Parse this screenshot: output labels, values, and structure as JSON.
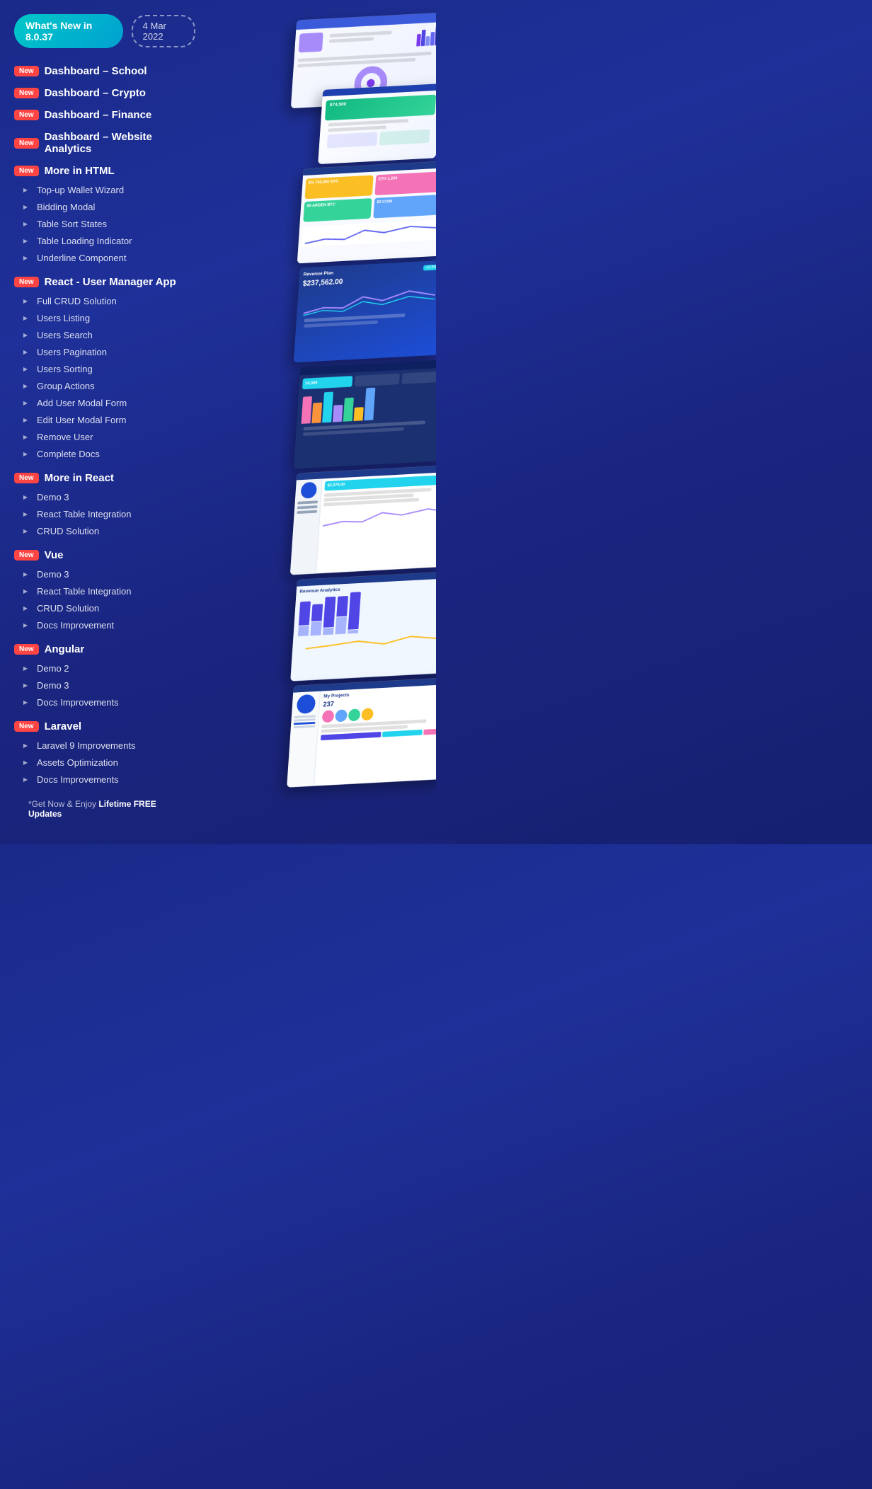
{
  "header": {
    "version_label": "What's New in 8.0.37",
    "date_label": "4 Mar 2022"
  },
  "sections": [
    {
      "id": "dashboard-school",
      "type": "new-item",
      "label": "Dashboard – School"
    },
    {
      "id": "dashboard-crypto",
      "type": "new-item",
      "label": "Dashboard – Crypto"
    },
    {
      "id": "dashboard-finance",
      "type": "new-item",
      "label": "Dashboard – Finance"
    },
    {
      "id": "dashboard-analytics",
      "type": "new-item",
      "label": "Dashboard – Website Analytics"
    },
    {
      "id": "more-html",
      "type": "new-section",
      "label": "More in HTML",
      "items": [
        "Top-up Wallet Wizard",
        "Bidding Modal",
        "Table Sort States",
        "Table Loading Indicator",
        "Underline Component"
      ]
    },
    {
      "id": "react-user-manager",
      "type": "new-section",
      "label": "React - User Manager App",
      "items": [
        "Full CRUD Solution",
        "Users Listing",
        "Users Search",
        "Users Pagination",
        "Users Sorting",
        "Group Actions",
        "Add User Modal Form",
        "Edit User Modal Form",
        "Remove User",
        "Complete Docs"
      ]
    },
    {
      "id": "more-react",
      "type": "new-section",
      "label": "More in React",
      "items": [
        "Demo 3",
        "React Table Integration",
        "CRUD Solution"
      ]
    },
    {
      "id": "vue",
      "type": "new-section",
      "label": "Vue",
      "items": [
        "Demo 3",
        "React Table Integration",
        "CRUD Solution",
        "Docs Improvement"
      ]
    },
    {
      "id": "angular",
      "type": "new-section",
      "label": "Angular",
      "items": [
        "Demo 2",
        "Demo 3",
        "Docs Improvements"
      ]
    },
    {
      "id": "laravel",
      "type": "new-section",
      "label": "Laravel",
      "items": [
        "Laravel 9 Improvements",
        "Assets Optimization",
        "Docs Improvements"
      ]
    }
  ],
  "footer": {
    "text_plain": "*Get Now & Enjoy ",
    "text_bold": "Lifetime FREE Updates"
  },
  "new_badge_label": "New",
  "colors": {
    "background_from": "#1a2a8a",
    "background_to": "#162070",
    "version_bg": "#00b8cc",
    "new_badge": "#ff4444",
    "accent_purple": "#7c3aed"
  }
}
